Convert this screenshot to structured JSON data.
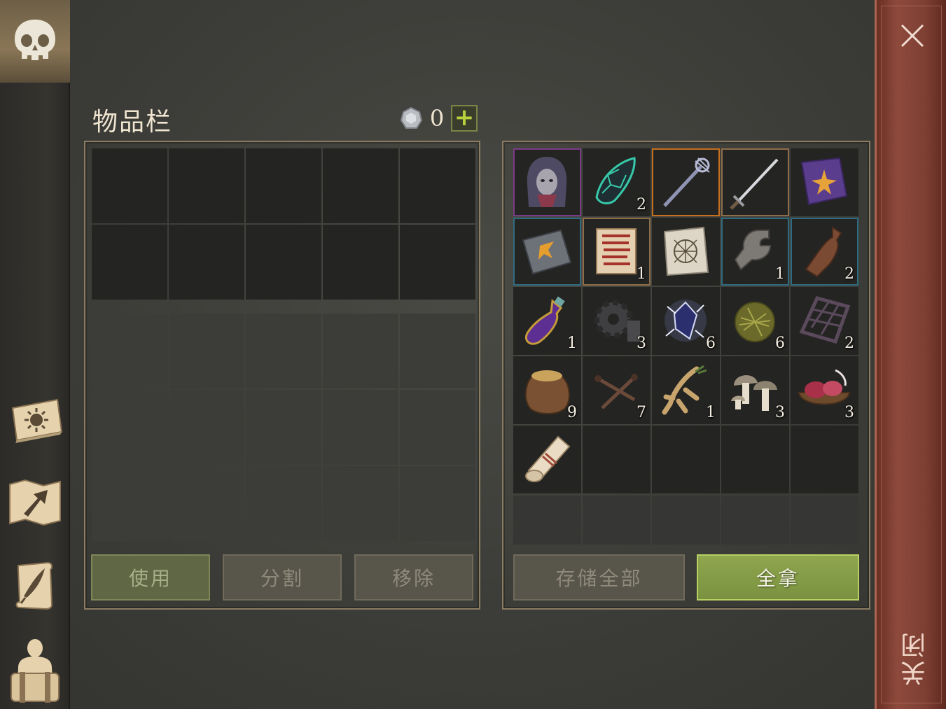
{
  "inventory": {
    "title": "物品栏",
    "currency_count": "0",
    "plus_label": "+",
    "buttons": {
      "use": "使用",
      "split": "分割",
      "remove": "移除"
    }
  },
  "loot": {
    "buttons": {
      "store_all": "存储全部",
      "take_all": "全拿"
    },
    "items": [
      {
        "icon": "hooded-figure-icon",
        "count": ""
      },
      {
        "icon": "dark-crystal-shard-icon",
        "count": "2"
      },
      {
        "icon": "staff-icon",
        "count": ""
      },
      {
        "icon": "sword-icon",
        "count": ""
      },
      {
        "icon": "purple-spellbook-icon",
        "count": ""
      },
      {
        "icon": "grey-book-icon",
        "count": ""
      },
      {
        "icon": "red-scroll-icon",
        "count": "1"
      },
      {
        "icon": "blueprint-scroll-icon",
        "count": ""
      },
      {
        "icon": "iron-clamp-icon",
        "count": "1"
      },
      {
        "icon": "bottle-icon",
        "count": "2"
      },
      {
        "icon": "potion-flask-icon",
        "count": "1"
      },
      {
        "icon": "gear-icon",
        "count": "3"
      },
      {
        "icon": "lightning-crystal-icon",
        "count": "6"
      },
      {
        "icon": "grass-ball-icon",
        "count": "6"
      },
      {
        "icon": "metal-grate-icon",
        "count": "2"
      },
      {
        "icon": "grain-sack-icon",
        "count": "9"
      },
      {
        "icon": "nails-icon",
        "count": "7"
      },
      {
        "icon": "root-icon",
        "count": "1"
      },
      {
        "icon": "mushrooms-icon",
        "count": "3"
      },
      {
        "icon": "raw-meat-bowl-icon",
        "count": "3"
      },
      {
        "icon": "parchment-roll-icon",
        "count": ""
      }
    ]
  },
  "closebar": {
    "label": "关闭"
  },
  "colors": {
    "accent_green": "#8fa64e",
    "close_red": "#7e3f33",
    "panel_border": "#8b7c61"
  }
}
